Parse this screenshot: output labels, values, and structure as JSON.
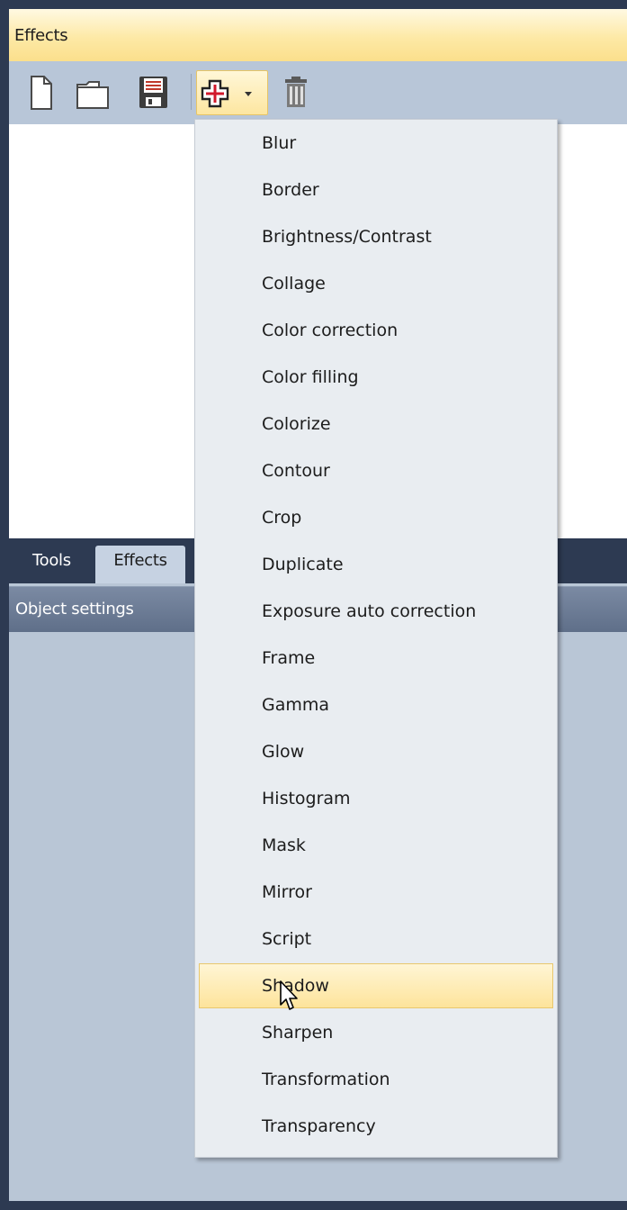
{
  "window": {
    "title": "Effects"
  },
  "toolbar": {
    "buttons": [
      {
        "icon": "new-document-icon"
      },
      {
        "icon": "open-folder-icon"
      },
      {
        "icon": "save-icon"
      },
      {
        "icon": "add-effect-icon",
        "has_dropdown": true,
        "active": true
      },
      {
        "icon": "trash-icon"
      }
    ]
  },
  "tabs": [
    {
      "label": "Tools",
      "active": false
    },
    {
      "label": "Effects",
      "active": true
    }
  ],
  "object_settings": {
    "title": "Object settings"
  },
  "effects_menu": {
    "items": [
      "Blur",
      "Border",
      "Brightness/Contrast",
      "Collage",
      "Color correction",
      "Color filling",
      "Colorize",
      "Contour",
      "Crop",
      "Duplicate",
      "Exposure auto correction",
      "Frame",
      "Gamma",
      "Glow",
      "Histogram",
      "Mask",
      "Mirror",
      "Script",
      "Shadow",
      "Sharpen",
      "Transformation",
      "Transparency"
    ],
    "hovered": "Shadow"
  },
  "colors": {
    "frame": "#2d3a52",
    "title_bar": "#fde9a6",
    "hover": "#fde39a",
    "menu_bg": "#e9edf1"
  }
}
